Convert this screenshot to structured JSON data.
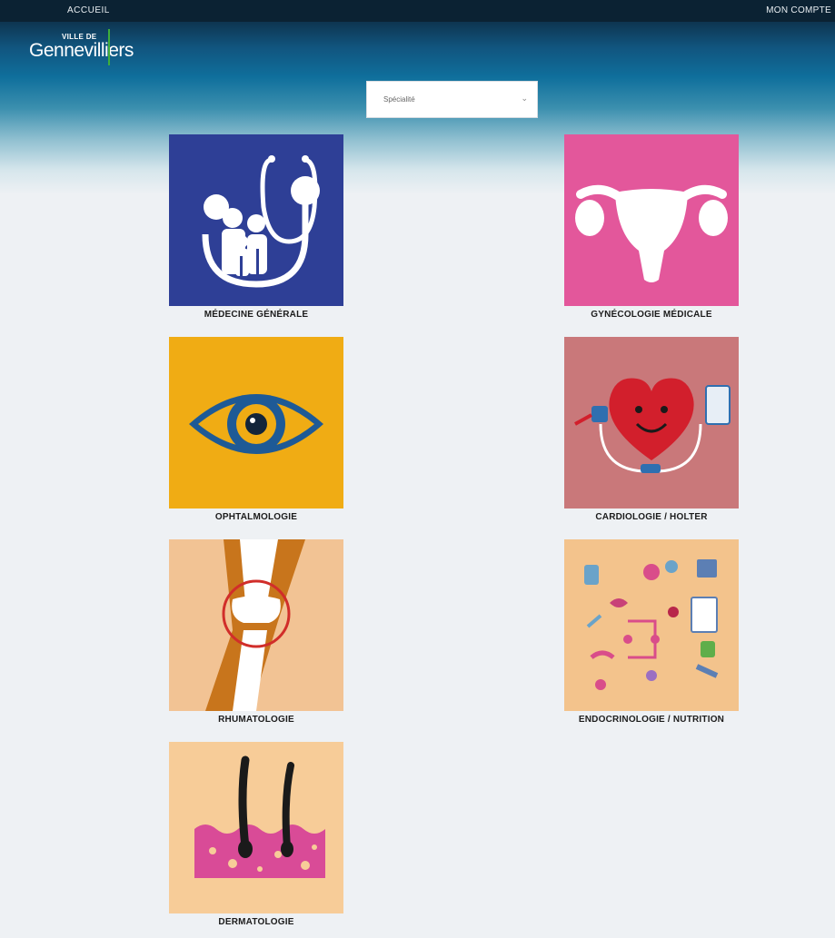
{
  "nav": {
    "home_label": "ACCUEIL",
    "account_label": "MON COMPTE"
  },
  "logo": {
    "small_text": "VILLE DE",
    "big_text": "Gennevilliers"
  },
  "filter": {
    "selected": "Spécialité",
    "chevron_icon": "chevron-down-icon"
  },
  "specialties": [
    {
      "label": "MÉDECINE GÉNÉRALE",
      "icon": "family-stethoscope-icon",
      "color": "#2e3f96"
    },
    {
      "label": "GYNÉCOLOGIE MÉDICALE",
      "icon": "uterus-icon",
      "color": "#e3579b"
    },
    {
      "label": "OPHTALMOLOGIE",
      "icon": "eye-icon",
      "color": "#f0ac14"
    },
    {
      "label": "CARDIOLOGIE / HOLTER",
      "icon": "heart-monitor-icon",
      "color": "#c9787a"
    },
    {
      "label": "RHUMATOLOGIE",
      "icon": "knee-joint-icon",
      "color": "#f2c394"
    },
    {
      "label": "ENDOCRINOLOGIE / NUTRITION",
      "icon": "endocrine-system-icon",
      "color": "#f3c38c"
    },
    {
      "label": "DERMATOLOGIE",
      "icon": "skin-hair-icon",
      "color": "#f7cc98"
    }
  ]
}
